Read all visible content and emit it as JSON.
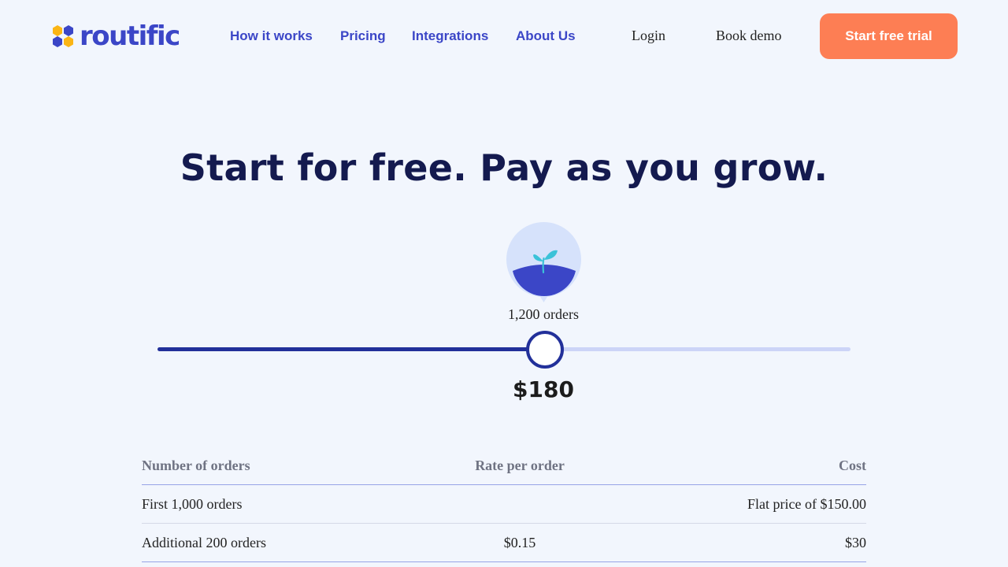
{
  "header": {
    "brand": "routific",
    "nav": [
      "How it works",
      "Pricing",
      "Integrations",
      "About Us"
    ],
    "login_label": "Login",
    "demo_label": "Book demo",
    "cta_label": "Start free trial",
    "colors": {
      "brand": "#3b46c7",
      "cta": "#fd7e54",
      "logo_yellow": "#fbb515"
    }
  },
  "hero": {
    "headline": "Start for free. Pay as you grow."
  },
  "calculator": {
    "icon": "sprout-icon",
    "orders_label": "1,200 orders",
    "slider_value_fraction": 0.559,
    "price": "$180",
    "colors": {
      "track_fill": "#22309a",
      "track_bg": "#ccd4f7"
    }
  },
  "table": {
    "headers": [
      "Number of orders",
      "Rate per order",
      "Cost"
    ],
    "rows": [
      [
        "First 1,000 orders",
        "",
        "Flat price of $150.00"
      ],
      [
        "Additional 200 orders",
        "$0.15",
        "$30"
      ]
    ]
  }
}
